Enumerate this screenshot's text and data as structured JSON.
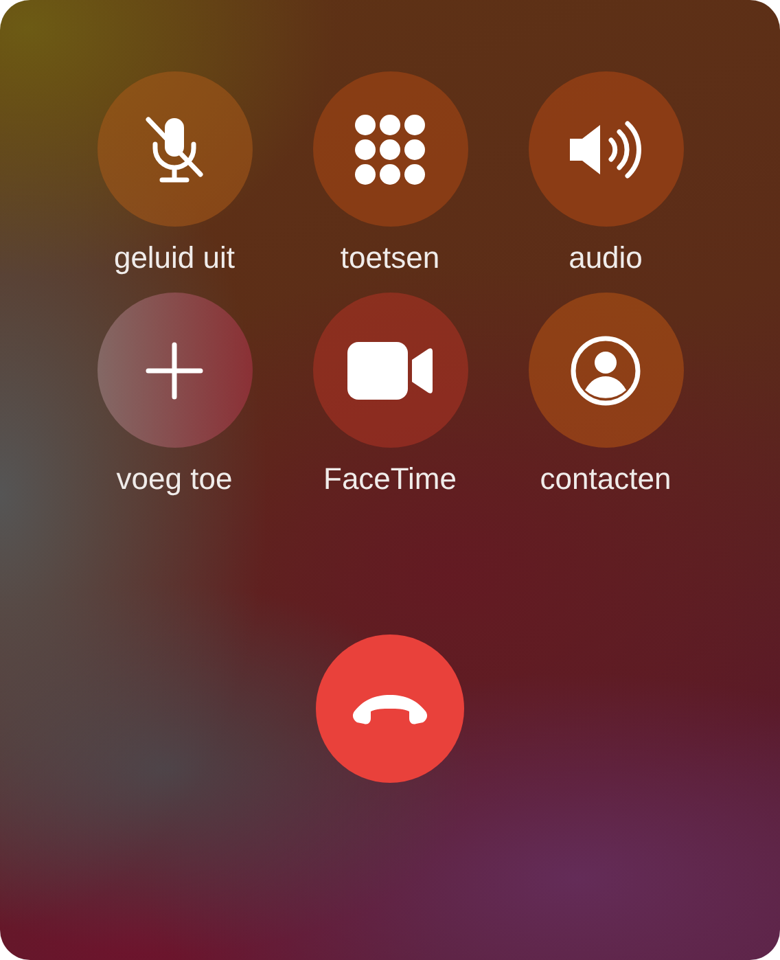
{
  "controls": [
    {
      "kind": "mute",
      "label": "geluid uit"
    },
    {
      "kind": "keypad",
      "label": "toetsen"
    },
    {
      "kind": "audio",
      "label": "audio"
    },
    {
      "kind": "add",
      "label": "voeg toe"
    },
    {
      "kind": "video",
      "label": "FaceTime"
    },
    {
      "kind": "contacts",
      "label": "contacten"
    }
  ]
}
